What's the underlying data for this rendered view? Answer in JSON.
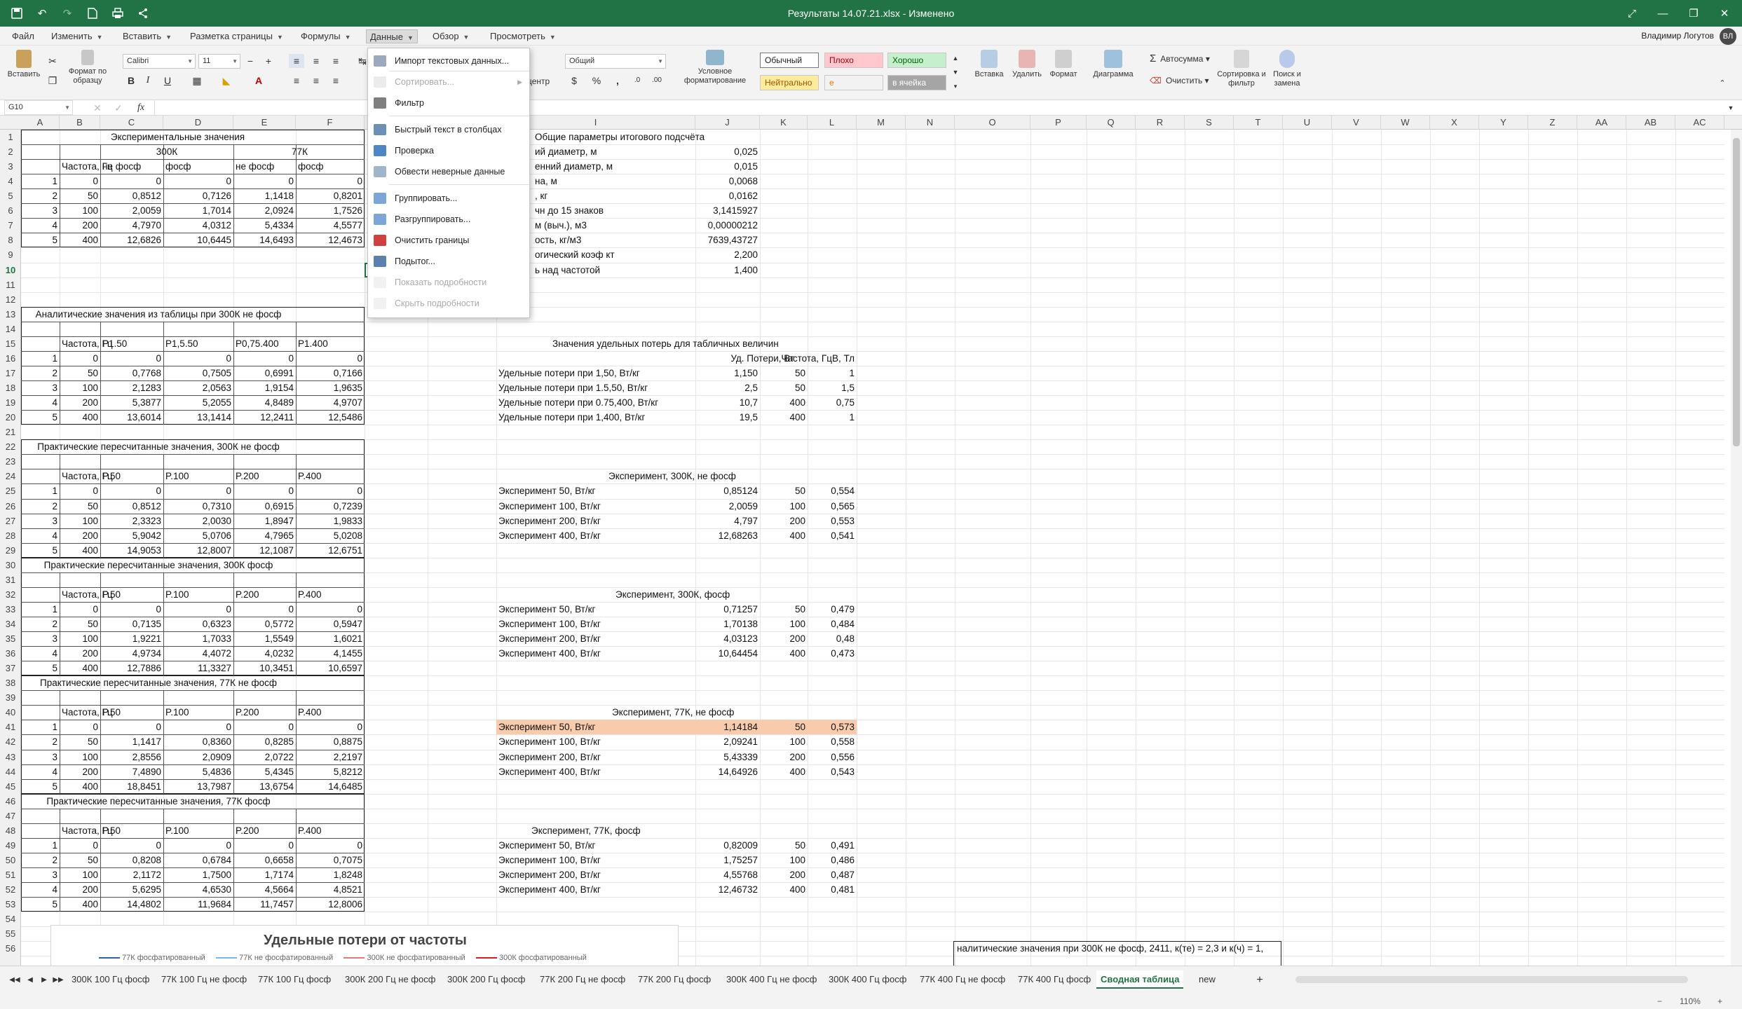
{
  "window": {
    "title": "Результаты 14.07.21.xlsx - Изменено"
  },
  "menu": [
    {
      "label": "Файл",
      "caret": false
    },
    {
      "label": "Изменить",
      "caret": true
    },
    {
      "label": "Вставить",
      "caret": true
    },
    {
      "label": "Разметка страницы",
      "caret": true
    },
    {
      "label": "Формулы",
      "caret": true
    },
    {
      "label": "Данные",
      "caret": true
    },
    {
      "label": "Обзор",
      "caret": true
    },
    {
      "label": "Просмотреть",
      "caret": true
    }
  ],
  "user": {
    "name": "Владимир Логутов"
  },
  "ribbon": {
    "paste": "Вставить",
    "format_painter": "Формат по образцу",
    "font_name": "Calibri",
    "font_size": "11",
    "number_format": "Общий",
    "center": "центр",
    "cond_format": "Условное форматирование",
    "styles": {
      "normal": "Обычный",
      "bad": "Плохо",
      "good": "Хорошо",
      "neutral": "Нейтрально",
      "input": "е",
      "note": "в ячейка"
    },
    "insert": "Вставка",
    "delete": "Удалить",
    "format": "Формат",
    "chart": "Диаграмма",
    "autosum": "Автосумма",
    "clear": "Очистить",
    "sort_filter": "Сортировка и фильтр",
    "find": "Поиск и замена"
  },
  "formula_bar": {
    "cell_ref": "G10",
    "fx": "fx",
    "value": ""
  },
  "dropdown": {
    "items": [
      {
        "label": "Импорт текстовых данных...",
        "disabled": false,
        "icon": "import-text-icon"
      },
      {
        "label": "Сортировать...",
        "disabled": true,
        "icon": "sort-icon",
        "submenu": true
      },
      {
        "label": "Фильтр",
        "disabled": false,
        "icon": "filter-icon"
      },
      {
        "label": "Быстрый текст в столбцах",
        "disabled": false,
        "icon": "text-to-columns-icon"
      },
      {
        "label": "Проверка",
        "disabled": false,
        "icon": "validation-icon"
      },
      {
        "label": "Обвести неверные данные",
        "disabled": false,
        "icon": "circle-invalid-icon"
      },
      {
        "label": "Группировать...",
        "disabled": false,
        "icon": "group-icon"
      },
      {
        "label": "Разгруппировать...",
        "disabled": false,
        "icon": "ungroup-icon"
      },
      {
        "label": "Очистить границы",
        "disabled": false,
        "icon": "clear-outline-icon"
      },
      {
        "label": "Подытог...",
        "disabled": false,
        "icon": "subtotal-icon"
      },
      {
        "label": "Показать подробности",
        "disabled": true,
        "icon": "show-detail-icon"
      },
      {
        "label": "Скрыть подробности",
        "disabled": true,
        "icon": "hide-detail-icon"
      }
    ]
  },
  "columns": [
    "A",
    "B",
    "C",
    "D",
    "E",
    "F",
    "G",
    "H",
    "I",
    "J",
    "K",
    "L",
    "M",
    "N",
    "O",
    "P",
    "Q",
    "R",
    "S",
    "T",
    "U",
    "V",
    "W",
    "X",
    "Y",
    "Z",
    "AA",
    "AB",
    "AC"
  ],
  "sheet": {
    "exp_title": "Экспериментальные значения",
    "t300": "300К",
    "t77": "77К",
    "freq": "Частота, Гц",
    "ne_fosf": "не фосф",
    "fosf": "фосф",
    "exp_rows": [
      [
        "1",
        "0",
        "0",
        "0",
        "0",
        "0"
      ],
      [
        "2",
        "50",
        "0,8512",
        "0,7126",
        "1,1418",
        "0,8201"
      ],
      [
        "3",
        "100",
        "2,0059",
        "1,7014",
        "2,0924",
        "1,7526"
      ],
      [
        "4",
        "200",
        "4,7970",
        "4,0312",
        "5,4334",
        "4,5577"
      ],
      [
        "5",
        "400",
        "12,6826",
        "10,6445",
        "14,6493",
        "12,4673"
      ]
    ],
    "an_title": "Аналитические значения из таблицы при 300К не фосф",
    "an_heads": [
      "Частота, Гц",
      "P1.50",
      "P1,5.50",
      "P0,75.400",
      "P1.400"
    ],
    "an_rows": [
      [
        "1",
        "0",
        "0",
        "0",
        "0",
        "0"
      ],
      [
        "2",
        "50",
        "0,7768",
        "0,7505",
        "0,6991",
        "0,7166"
      ],
      [
        "3",
        "100",
        "2,1283",
        "2,0563",
        "1,9154",
        "1,9635"
      ],
      [
        "4",
        "200",
        "5,3877",
        "5,2055",
        "4,8489",
        "4,9707"
      ],
      [
        "5",
        "400",
        "13,6014",
        "13,1414",
        "12,2411",
        "12,5486"
      ]
    ],
    "p_heads": [
      "Частота, Гц",
      "P.50",
      "P.100",
      "P.200",
      "P.400"
    ],
    "p1_title": "Практические пересчитанные значения, 300К не фосф",
    "p1_rows": [
      [
        "1",
        "0",
        "0",
        "0",
        "0",
        "0"
      ],
      [
        "2",
        "50",
        "0,8512",
        "0,7310",
        "0,6915",
        "0,7239"
      ],
      [
        "3",
        "100",
        "2,3323",
        "2,0030",
        "1,8947",
        "1,9833"
      ],
      [
        "4",
        "200",
        "5,9042",
        "5,0706",
        "4,7965",
        "5,0208"
      ],
      [
        "5",
        "400",
        "14,9053",
        "12,8007",
        "12,1087",
        "12,6751"
      ]
    ],
    "p2_title": "Практические пересчитанные значения, 300К фосф",
    "p2_rows": [
      [
        "1",
        "0",
        "0",
        "0",
        "0",
        "0"
      ],
      [
        "2",
        "50",
        "0,7135",
        "0,6323",
        "0,5772",
        "0,5947"
      ],
      [
        "3",
        "100",
        "1,9221",
        "1,7033",
        "1,5549",
        "1,6021"
      ],
      [
        "4",
        "200",
        "4,9734",
        "4,4072",
        "4,0232",
        "4,1455"
      ],
      [
        "5",
        "400",
        "12,7886",
        "11,3327",
        "10,3451",
        "10,6597"
      ]
    ],
    "p3_title": "Практические пересчитанные значения, 77К не фосф",
    "p3_rows": [
      [
        "1",
        "0",
        "0",
        "0",
        "0",
        "0"
      ],
      [
        "2",
        "50",
        "1,1417",
        "0,8360",
        "0,8285",
        "0,8875"
      ],
      [
        "3",
        "100",
        "2,8556",
        "2,0909",
        "2,0722",
        "2,2197"
      ],
      [
        "4",
        "200",
        "7,4890",
        "5,4836",
        "5,4345",
        "5,8212"
      ],
      [
        "5",
        "400",
        "18,8451",
        "13,7987",
        "13,6754",
        "14,6485"
      ]
    ],
    "p4_title": "Практические пересчитанные значения, 77К фосф",
    "p4_rows": [
      [
        "1",
        "0",
        "0",
        "0",
        "0",
        "0"
      ],
      [
        "2",
        "50",
        "0,8208",
        "0,6784",
        "0,6658",
        "0,7075"
      ],
      [
        "3",
        "100",
        "2,1172",
        "1,7500",
        "1,7174",
        "1,8248"
      ],
      [
        "4",
        "200",
        "5,6295",
        "4,6530",
        "4,5664",
        "4,8521"
      ],
      [
        "5",
        "400",
        "14,4802",
        "11,9684",
        "11,7457",
        "12,8006"
      ]
    ],
    "params_title": "Общие параметры итогового подсчёта",
    "params": [
      [
        "ий диаметр, м",
        "0,025"
      ],
      [
        "енний диаметр, м",
        "0,015"
      ],
      [
        "на, м",
        "0,0068"
      ],
      [
        ", кг",
        "0,0162"
      ],
      [
        "чн до 15 знаков",
        "3,1415927"
      ],
      [
        "м (выч.), м3",
        "0,00000212"
      ],
      [
        "ость, кг/м3",
        "7639,43727"
      ],
      [
        "огический коэф кт",
        "2,200"
      ],
      [
        "ь над частотой",
        "1,400"
      ]
    ],
    "sp_title": "Значения удельных потерь для табличных величин",
    "sp_heads": [
      "Уд. Потери, Вт",
      "Частота, ГцВ, Тл"
    ],
    "sp_rows": [
      [
        "Удельные потери при 1,50, Вт/кг",
        "1,150",
        "50",
        "1"
      ],
      [
        "Удельные потери при 1.5,50, Вт/кг",
        "2,5",
        "50",
        "1,5"
      ],
      [
        "Удельные потери при 0.75,400, Вт/кг",
        "10,7",
        "400",
        "0,75"
      ],
      [
        "Удельные потери при 1,400, Вт/кг",
        "19,5",
        "400",
        "1"
      ]
    ],
    "e1_title": "Эксперимент, 300К, не фосф",
    "e1_rows": [
      [
        "Эксперимент 50, Вт/кг",
        "0,85124",
        "50",
        "0,554"
      ],
      [
        "Эксперимент 100, Вт/кг",
        "2,0059",
        "100",
        "0,565"
      ],
      [
        "Эксперимент 200, Вт/кг",
        "4,797",
        "200",
        "0,553"
      ],
      [
        "Эксперимент 400, Вт/кг",
        "12,68263",
        "400",
        "0,541"
      ]
    ],
    "e2_title": "Эксперимент, 300К, фосф",
    "e2_rows": [
      [
        "Эксперимент 50, Вт/кг",
        "0,71257",
        "50",
        "0,479"
      ],
      [
        "Эксперимент 100, Вт/кг",
        "1,70138",
        "100",
        "0,484"
      ],
      [
        "Эксперимент 200, Вт/кг",
        "4,03123",
        "200",
        "0,48"
      ],
      [
        "Эксперимент 400, Вт/кг",
        "10,64454",
        "400",
        "0,473"
      ]
    ],
    "e3_title": "Эксперимент, 77К, не фосф",
    "e3_rows": [
      [
        "Эксперимент 50, Вт/кг",
        "1,14184",
        "50",
        "0,573"
      ],
      [
        "Эксперимент 100, Вт/кг",
        "2,09241",
        "100",
        "0,558"
      ],
      [
        "Эксперимент 200, Вт/кг",
        "5,43339",
        "200",
        "0,556"
      ],
      [
        "Эксперимент 400, Вт/кг",
        "14,64926",
        "400",
        "0,543"
      ]
    ],
    "e4_title": "Эксперимент, 77К, фосф",
    "e4_rows": [
      [
        "Эксперимент 50, Вт/кг",
        "0,82009",
        "50",
        "0,491"
      ],
      [
        "Эксперимент 100, Вт/кг",
        "1,75257",
        "100",
        "0,486"
      ],
      [
        "Эксперимент 200, Вт/кг",
        "4,55768",
        "200",
        "0,487"
      ],
      [
        "Эксперимент 400, Вт/кг",
        "12,46732",
        "400",
        "0,481"
      ]
    ],
    "bottom_note": "налитические значения при 300К не фосф, 2411, к(те) = 2,3 и к(ч) = 1,"
  },
  "chart": {
    "title": "Удельные потери от частоты",
    "legend": [
      "77К фосфатированный",
      "77К не фосфатированный",
      "300К не фосфатированный",
      "300К фосфатированный"
    ],
    "colors": [
      "#2e5fa8",
      "#7ab6e6",
      "#e07b7b",
      "#d02020"
    ]
  },
  "tabs": [
    "300К 100 Гц фосф",
    "77К 100 Гц не фосф",
    "77К 100 Гц фосф",
    "300К 200 Гц не фосф",
    "300К 200 Гц фосф",
    "77К 200 Гц не фосф",
    "77К 200 Гц фосф",
    "300К 400 Гц не фосф",
    "300К 400 Гц фосф",
    "77К 400 Гц не фосф",
    "77К 400 Гц фосф",
    "Сводная таблица",
    "new"
  ],
  "active_tab": "Сводная таблица",
  "status": {
    "zoom": "110%"
  },
  "highlight_color": "#f8cbad",
  "accent": "#217346"
}
